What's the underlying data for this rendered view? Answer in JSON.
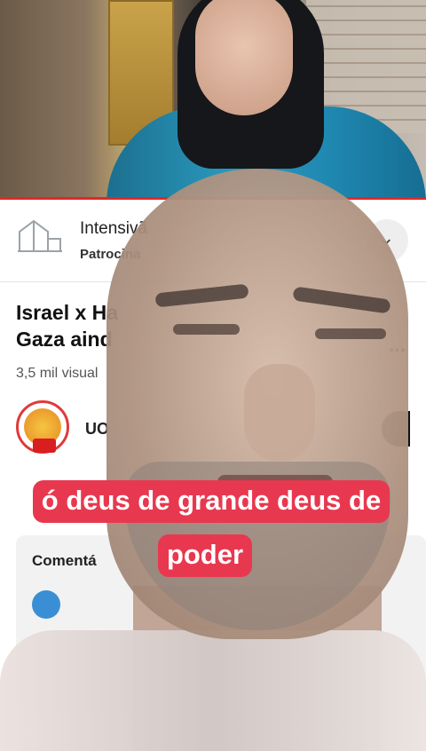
{
  "ad": {
    "title": "Intensivã",
    "subtitle": "Patrocina",
    "chevron": "chevron-down-icon"
  },
  "video": {
    "title_line1": "Israel x Ha",
    "title_line2": "Gaza aind",
    "title_trailing": "...",
    "views": "3,5 mil visual"
  },
  "channel": {
    "name": "UO"
  },
  "comments": {
    "label": "Comentá"
  },
  "caption": {
    "line1": "ó deus de grande deus de",
    "line2": "poder"
  },
  "colors": {
    "caption_bg": "#e8384f",
    "divider": "#e02828",
    "live_badge": "#d81e1e"
  }
}
